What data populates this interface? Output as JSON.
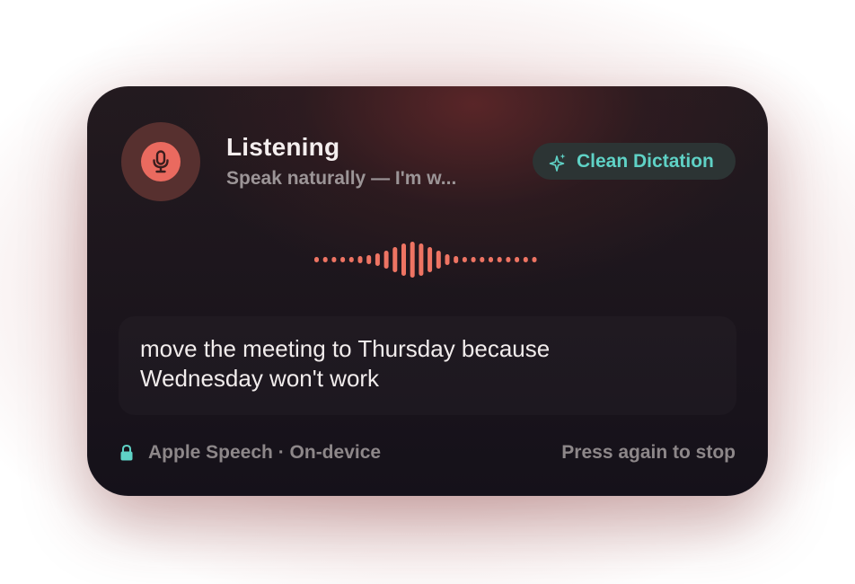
{
  "status": {
    "title": "Listening",
    "subtitle": "Speak naturally — I'm w..."
  },
  "mic": {
    "icon": "microphone-icon",
    "color": "#ea6a5f"
  },
  "clean_dictation": {
    "label": "Clean Dictation",
    "icon": "sparkles-icon",
    "color": "#5fd2c6"
  },
  "waveform": {
    "icon": "audio-waveform",
    "color": "#ee7463"
  },
  "transcript": {
    "text": "move the meeting to Thursday because Wednesday won't work"
  },
  "footer": {
    "engine_label": "Apple Speech · On-device",
    "lock_icon": "lock-icon",
    "hint": "Press again to stop"
  }
}
